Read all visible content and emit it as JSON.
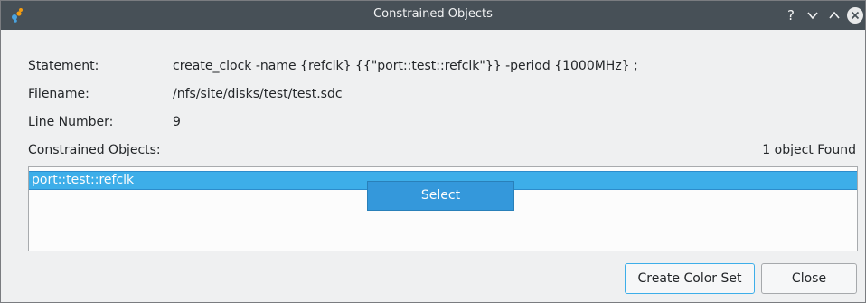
{
  "window": {
    "title": "Constrained Objects",
    "help_glyph": "?",
    "titlebar_buttons": [
      "help-icon",
      "chevron-down-icon",
      "chevron-up-icon",
      "close-icon"
    ]
  },
  "details": {
    "statement_label": "Statement:",
    "statement_value": "create_clock -name {refclk} {{\"port::test::refclk\"}} -period {1000MHz} ;",
    "filename_label": "Filename:",
    "filename_value": "/nfs/site/disks/test/test.sdc",
    "line_number_label": "Line Number:",
    "line_number_value": "9",
    "constrained_objects_label": "Constrained Objects:",
    "found_count": "1 object Found"
  },
  "objects": {
    "items": [
      {
        "label": "port::test::refclk",
        "selected": true
      }
    ],
    "popup_label": "Select"
  },
  "buttons": {
    "create_color_set": "Create Color Set",
    "close": "Close"
  },
  "colors": {
    "titlebar": "#475057",
    "selection": "#3daee9",
    "popup": "#3498db",
    "window_bg": "#eff0f1"
  }
}
